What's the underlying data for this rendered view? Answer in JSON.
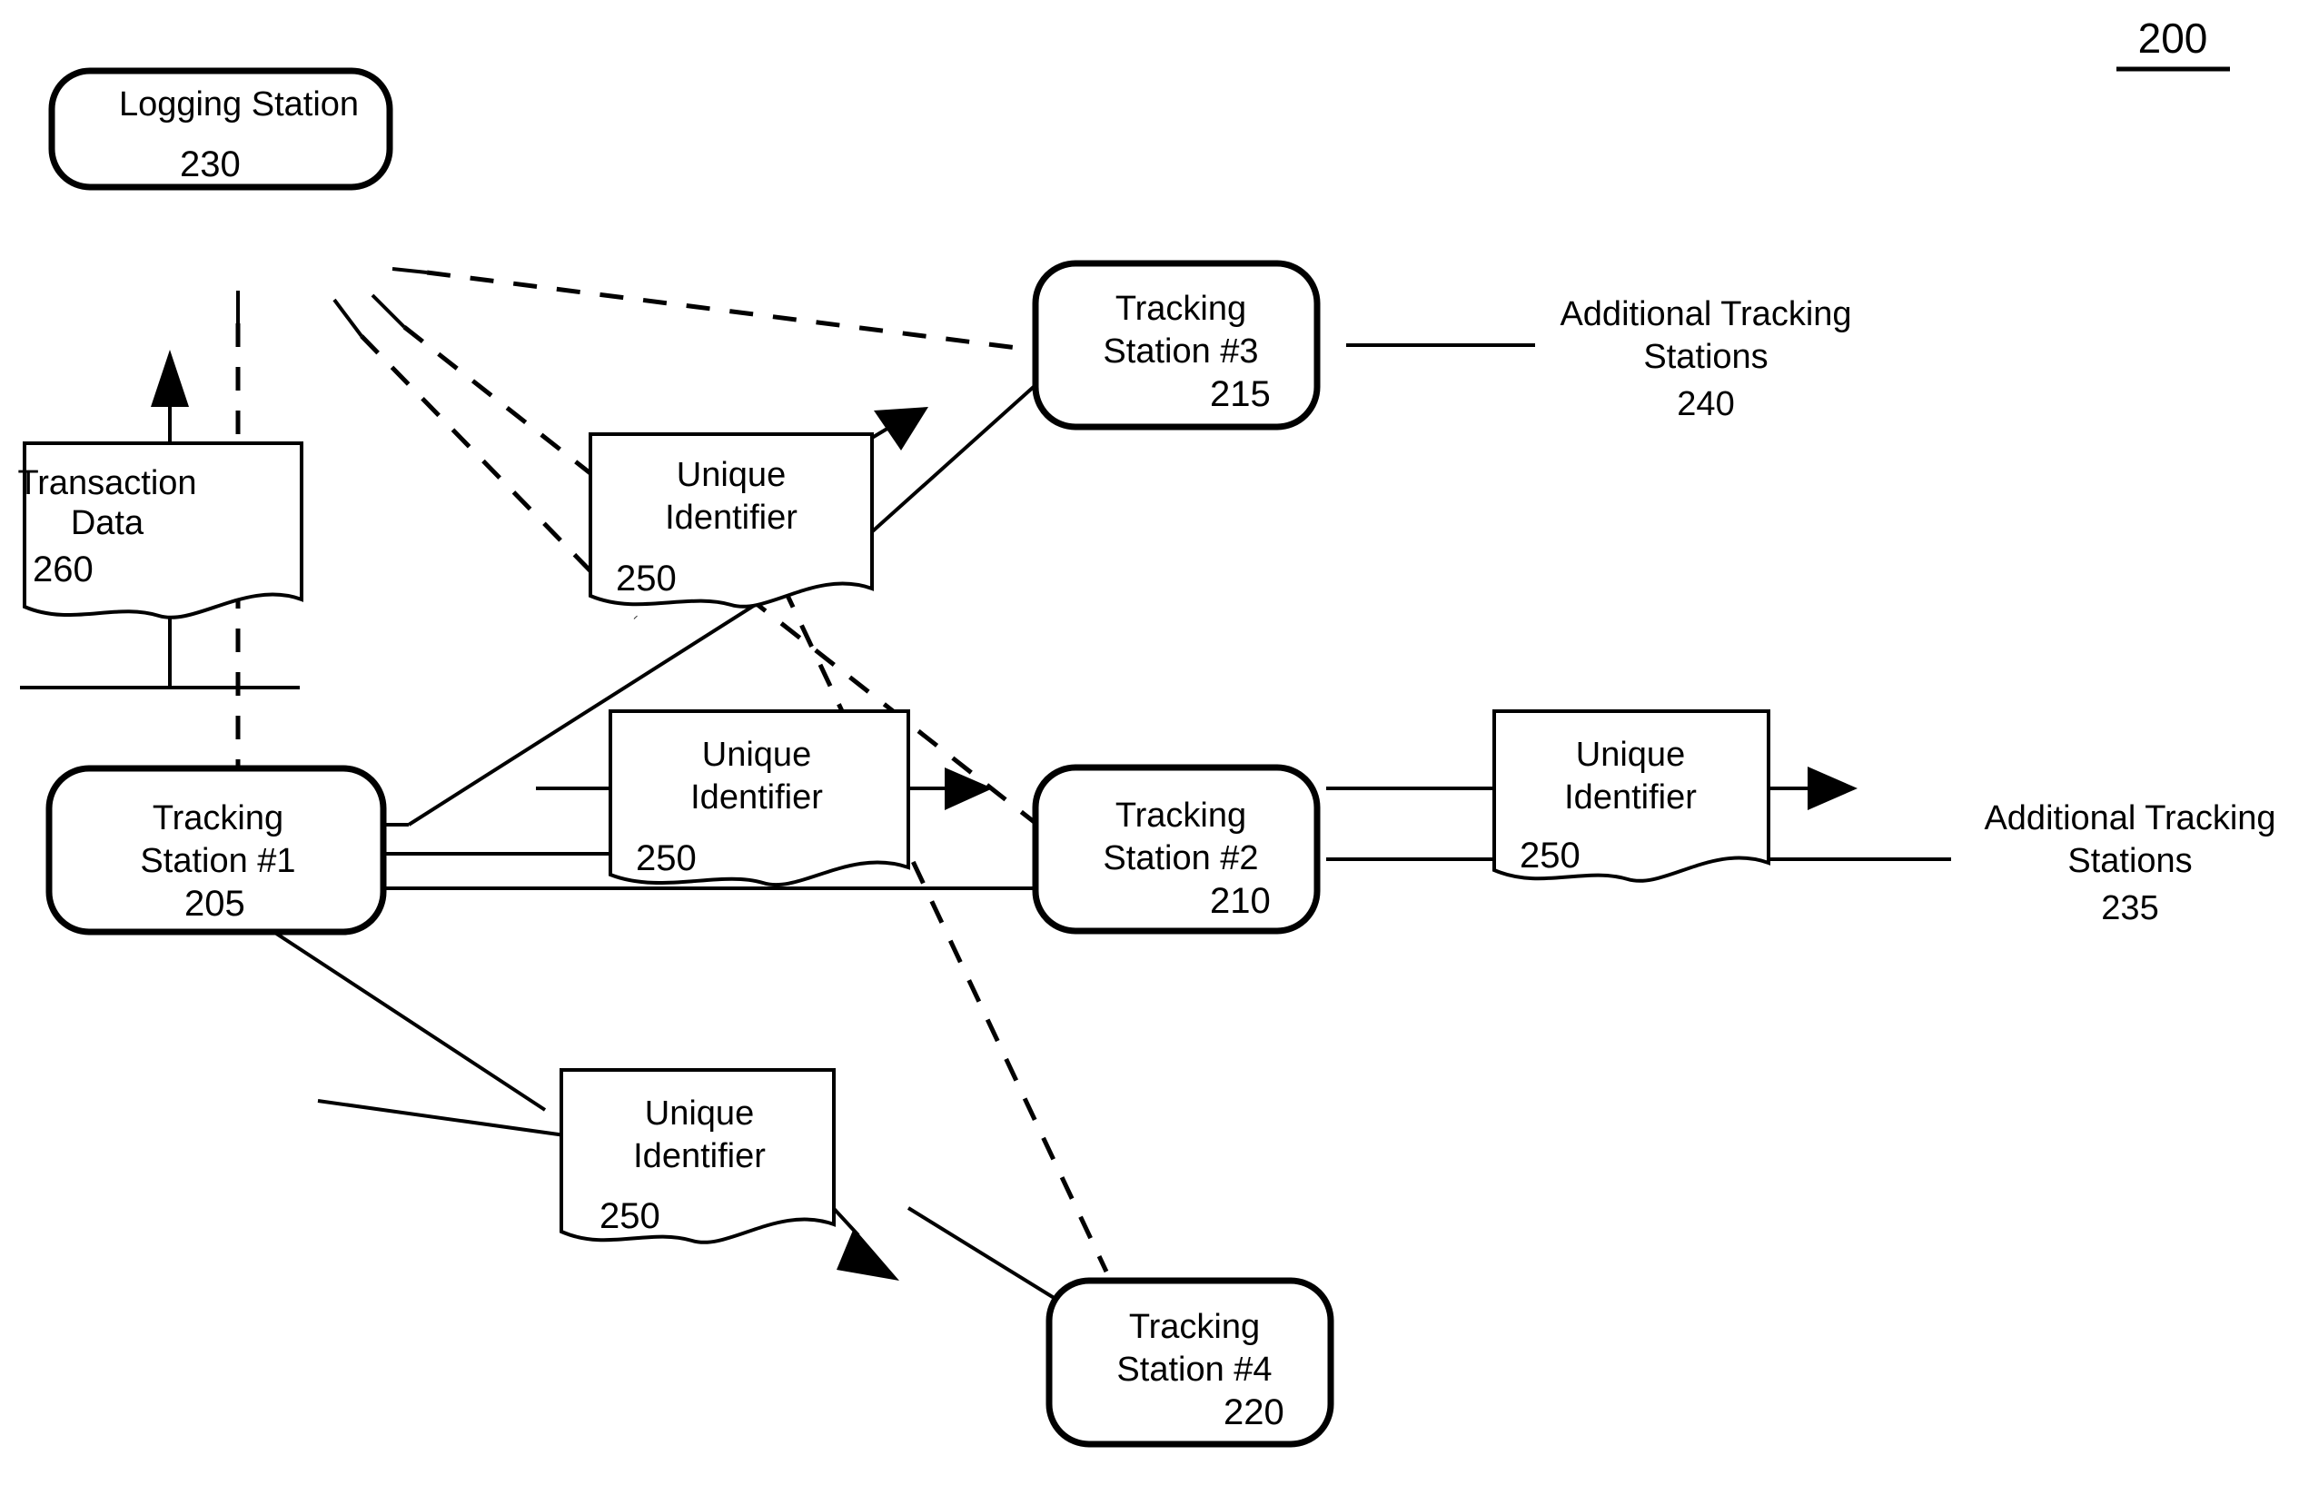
{
  "figure": {
    "number": "200",
    "title_underlined": true
  },
  "nodes": {
    "logging_station": {
      "label_line1": "Logging Station",
      "ref": "230"
    },
    "transaction_data": {
      "label_line1": "Transaction",
      "label_line2": "Data",
      "ref": "260"
    },
    "tracking_station_1": {
      "label_line1": "Tracking",
      "label_line2": "Station #1",
      "ref": "205"
    },
    "tracking_station_2": {
      "label_line1": "Tracking",
      "label_line2": "Station #2",
      "ref": "210"
    },
    "tracking_station_3": {
      "label_line1": "Tracking",
      "label_line2": "Station #3",
      "ref": "215"
    },
    "tracking_station_4": {
      "label_line1": "Tracking",
      "label_line2": "Station #4",
      "ref": "220"
    },
    "unique_identifier_top": {
      "label_line1": "Unique",
      "label_line2": "Identifier",
      "ref": "250"
    },
    "unique_identifier_middle_left": {
      "label_line1": "Unique",
      "label_line2": "Identifier",
      "ref": "250"
    },
    "unique_identifier_middle_right": {
      "label_line1": "Unique",
      "label_line2": "Identifier",
      "ref": "250"
    },
    "unique_identifier_bottom": {
      "label_line1": "Unique",
      "label_line2": "Identifier",
      "ref": "250"
    },
    "additional_tracking_stations_top": {
      "label_line1": "Additional Tracking",
      "label_line2": "Stations",
      "ref": "240"
    },
    "additional_tracking_stations_right": {
      "label_line1": "Additional Tracking",
      "label_line2": "Stations",
      "ref": "235"
    }
  },
  "colors": {
    "stroke": "#000000",
    "fill": "#ffffff",
    "background": "#ffffff"
  }
}
